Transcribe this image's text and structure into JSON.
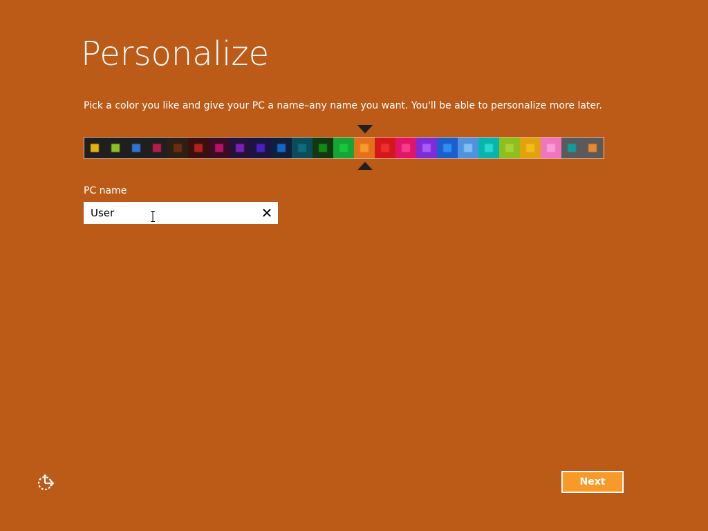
{
  "page": {
    "title": "Personalize",
    "subtitle": "Pick a color you like and give your PC a name–any name you want. You'll be able to personalize more later.",
    "background_color": "#bc5a17"
  },
  "color_picker": {
    "selected_index": 13,
    "swatches": [
      {
        "bg": "#1f1f1f",
        "dot": "#e1b30f"
      },
      {
        "bg": "#1f1f1f",
        "dot": "#8cbf26"
      },
      {
        "bg": "#1f1f1f",
        "dot": "#2e73d8"
      },
      {
        "bg": "#1f1f1f",
        "dot": "#b81b4b"
      },
      {
        "bg": "#2d1f14",
        "dot": "#6a2e0c"
      },
      {
        "bg": "#3a0f0f",
        "dot": "#b3201d"
      },
      {
        "bg": "#3a0d25",
        "dot": "#bb1069"
      },
      {
        "bg": "#24123a",
        "dot": "#7b1fb6"
      },
      {
        "bg": "#1a1540",
        "dot": "#4a1fbf"
      },
      {
        "bg": "#0f1f3c",
        "dot": "#1466c6"
      },
      {
        "bg": "#0c4b5a",
        "dot": "#0a6e7e"
      },
      {
        "bg": "#123812",
        "dot": "#138a14"
      },
      {
        "bg": "#14a534",
        "dot": "#1bc63e"
      },
      {
        "bg": "#e3711c",
        "dot": "#f79a2a"
      },
      {
        "bg": "#d3181c",
        "dot": "#f02e2e"
      },
      {
        "bg": "#e0156a",
        "dot": "#f23f8b"
      },
      {
        "bg": "#7d2cd8",
        "dot": "#a95bf5"
      },
      {
        "bg": "#1a5fcc",
        "dot": "#2f8ff0"
      },
      {
        "bg": "#4f93e0",
        "dot": "#82bef0"
      },
      {
        "bg": "#06b5ae",
        "dot": "#2dd6cf"
      },
      {
        "bg": "#8dbf1e",
        "dot": "#a8d232"
      },
      {
        "bg": "#e2a20e",
        "dot": "#f2bd1a"
      },
      {
        "bg": "#ef76bc",
        "dot": "#f59ed4"
      },
      {
        "bg": "#5a5a5a",
        "dot": "#0f9d9d"
      },
      {
        "bg": "#5a5a5a",
        "dot": "#f0852a"
      }
    ]
  },
  "pc_name": {
    "label": "PC name",
    "value": "User",
    "clear_icon": "close-icon",
    "clear_glyph": "✕"
  },
  "footer": {
    "ease_of_access_icon": "ease-of-access-icon",
    "next_label": "Next",
    "next_color": "#f79a2a"
  }
}
